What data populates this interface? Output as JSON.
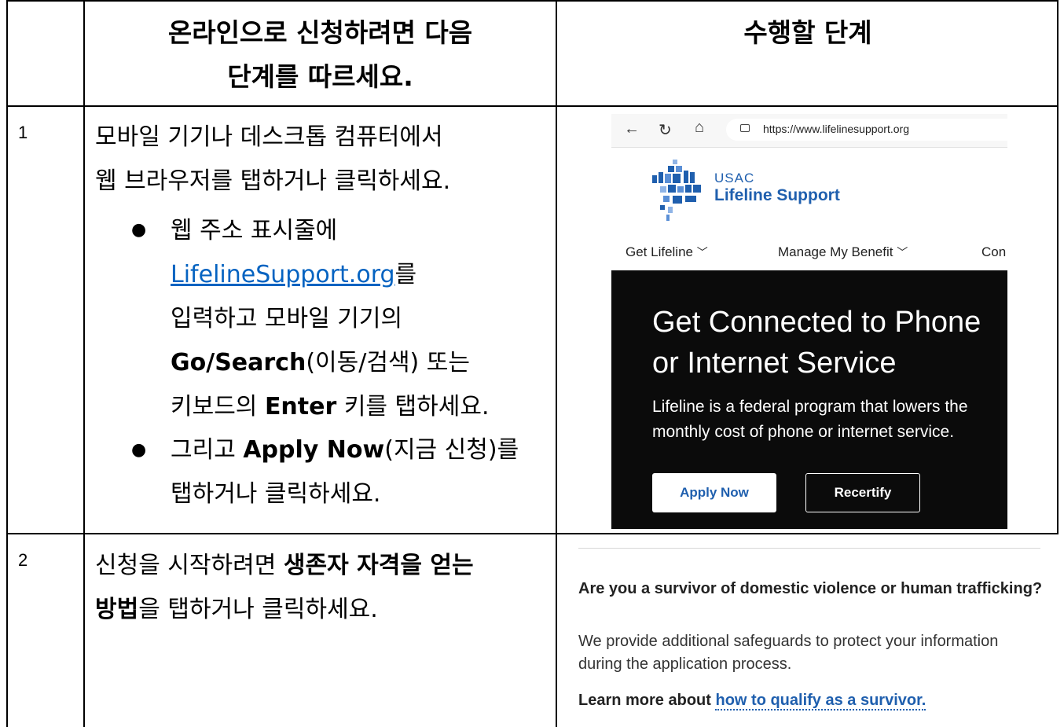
{
  "table": {
    "header": {
      "col2_line1": "온라인으로 신청하려면 다음",
      "col2_line2": "단계를 따르세요.",
      "col3": "수행할 단계"
    },
    "row1": {
      "number": "1",
      "line1": "모바일 기기나 데스크톱 컴퓨터에서",
      "line2": "웹 브라우저를 탭하거나 클릭하세요.",
      "bullet1": {
        "line1": "웹 주소 표시줄에",
        "link": "LifelineSupport.org",
        "after_link": "를",
        "line3": "입력하고 모바일 기기의",
        "bold_go": "Go/Search",
        "after_go": "(이동/검색) 또는",
        "line5_pre": "키보드의 ",
        "bold_enter": "Enter",
        "line5_post": " 키를 탭하세요."
      },
      "bullet2": {
        "pre": "그리고 ",
        "bold": "Apply Now",
        "post": "(지금 신청)를",
        "line2": "탭하거나 클릭하세요."
      }
    },
    "row2": {
      "number": "2",
      "line1_pre": "신청을 시작하려면 ",
      "line1_bold": "생존자 자격을 얻는",
      "line2_bold": "방법",
      "line2_post": "을 탭하거나 클릭하세요."
    }
  },
  "screenshot1": {
    "url": "https://www.lifelinesupport.org",
    "brand_small": "USAC",
    "brand_large": "Lifeline Support",
    "menu": [
      "Get Lifeline",
      "Manage My Benefit",
      "Con"
    ],
    "hero_title": "Get Connected to Phone or Internet Service",
    "hero_subtitle": "Lifeline is a federal program that lowers the monthly cost of phone or internet service.",
    "apply_button": "Apply Now",
    "recertify_button": "Recertify",
    "brand_color": "#1f5fae"
  },
  "screenshot2": {
    "question": "Are you a survivor of domestic violence or human trafficking?",
    "description": "We provide additional safeguards to protect your information during the application process.",
    "learn_pre": "Learn more about ",
    "learn_link": "how to qualify as a survivor."
  }
}
